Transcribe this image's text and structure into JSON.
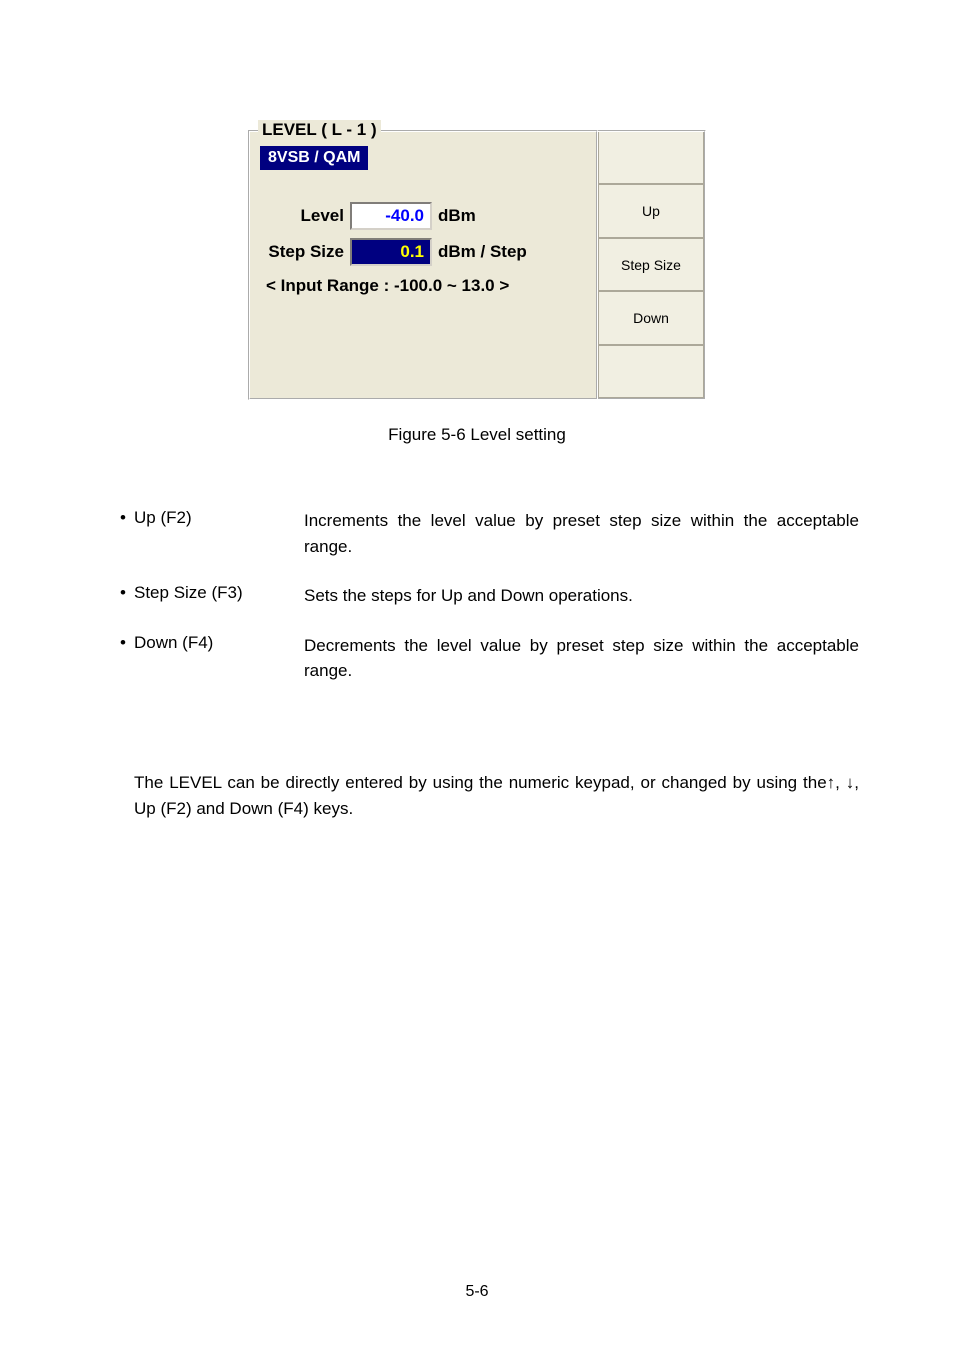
{
  "panel": {
    "title": "LEVEL ( L - 1 )",
    "mode": "8VSB / QAM",
    "level_label": "Level",
    "level_value": "-40.0",
    "level_unit": "dBm",
    "step_label": "Step Size",
    "step_value": "0.1",
    "step_unit": "dBm / Step",
    "range_text": "< Input Range : -100.0 ~ 13.0 >"
  },
  "soft_buttons": {
    "f1": "",
    "f2": "Up",
    "f3": "Step Size",
    "f4": "Down",
    "f5": ""
  },
  "caption": "Figure 5-6   Level setting",
  "bullets": {
    "up": {
      "term": "Up (F2)",
      "desc": "Increments the level value by preset step size within the acceptable range."
    },
    "step": {
      "term": "Step Size (F3)",
      "desc": "Sets the steps for Up and Down operations."
    },
    "down": {
      "term": "Down (F4)",
      "desc": "Decrements the level value by preset step size within the acceptable range."
    }
  },
  "note": "The LEVEL can be directly entered by using the numeric keypad, or changed by using the↑, ↓, Up (F2) and Down (F4) keys.",
  "page_number": "5-6"
}
